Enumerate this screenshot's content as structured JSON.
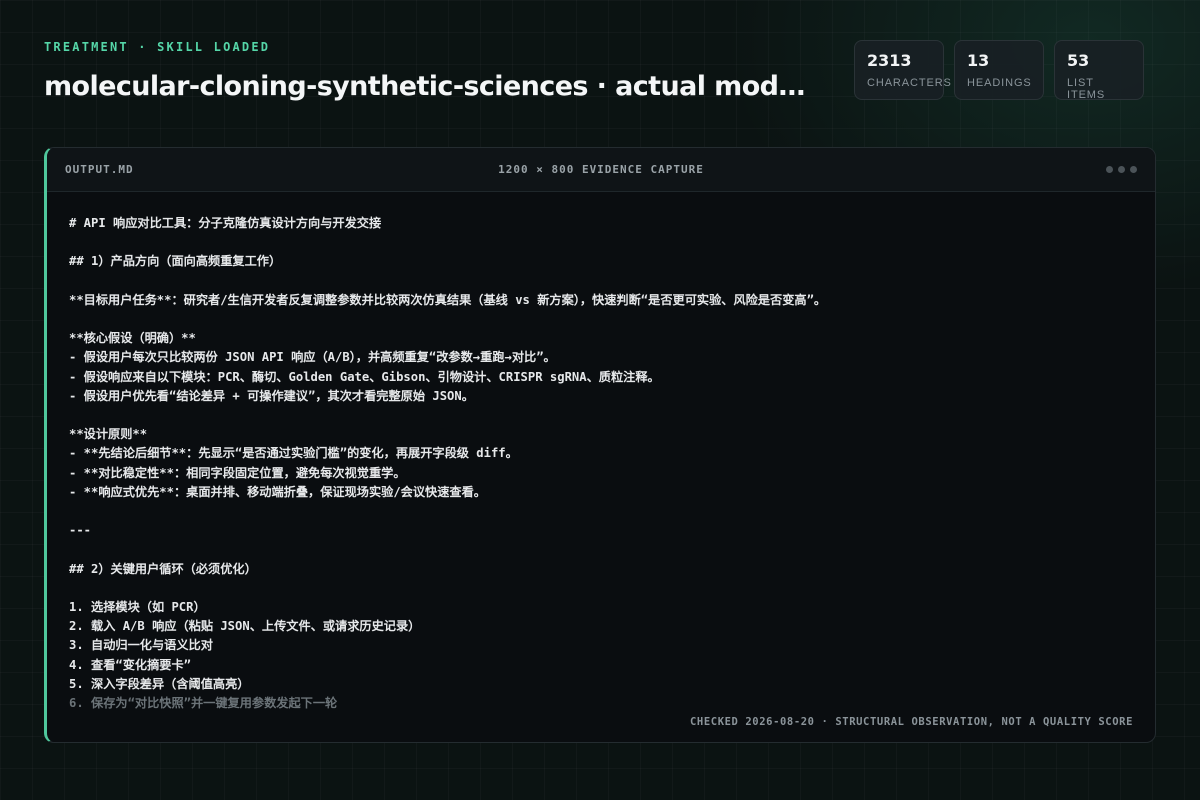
{
  "header": {
    "eyebrow": "TREATMENT · SKILL LOADED",
    "title": "molecular-cloning-synthetic-sciences · actual model ar..."
  },
  "stats": [
    {
      "value": "2313",
      "label": "CHARACTERS"
    },
    {
      "value": "13",
      "label": "HEADINGS"
    },
    {
      "value": "53",
      "label": "LIST ITEMS"
    }
  ],
  "panel": {
    "file_name": "OUTPUT.MD",
    "capture_label": "1200 × 800 EVIDENCE CAPTURE",
    "footer_note": "CHECKED 2026-08-20 · STRUCTURAL OBSERVATION, NOT A QUALITY SCORE",
    "lines": [
      "# API 响应对比工具：分子克隆仿真设计方向与开发交接",
      "",
      "## 1）产品方向（面向高频重复工作）",
      "",
      "**目标用户任务**：研究者/生信开发者反复调整参数并比较两次仿真结果（基线 vs 新方案），快速判断“是否更可实验、风险是否变高”。",
      "",
      "**核心假设（明确）**",
      "- 假设用户每次只比较两份 JSON API 响应（A/B），并高频重复“改参数→重跑→对比”。",
      "- 假设响应来自以下模块：PCR、酶切、Golden Gate、Gibson、引物设计、CRISPR sgRNA、质粒注释。",
      "- 假设用户优先看“结论差异 + 可操作建议”，其次才看完整原始 JSON。",
      "",
      "**设计原则**",
      "- **先结论后细节**：先显示“是否通过实验门槛”的变化，再展开字段级 diff。",
      "- **对比稳定性**：相同字段固定位置，避免每次视觉重学。",
      "- **响应式优先**：桌面并排、移动端折叠，保证现场实验/会议快速查看。",
      "",
      "---",
      "",
      "## 2）关键用户循环（必须优化）",
      "",
      "1. 选择模块（如 PCR）",
      "2. 载入 A/B 响应（粘贴 JSON、上传文件、或请求历史记录）",
      "3. 自动归一化与语义比对",
      "4. 查看“变化摘要卡”",
      "5. 深入字段差异（含阈值高亮）",
      "6. 保存为“对比快照”并一键复用参数发起下一轮"
    ]
  },
  "colors": {
    "accent": "#55d6a8",
    "panel_border_accent": "#4fc79c",
    "background": "#0b1312"
  }
}
